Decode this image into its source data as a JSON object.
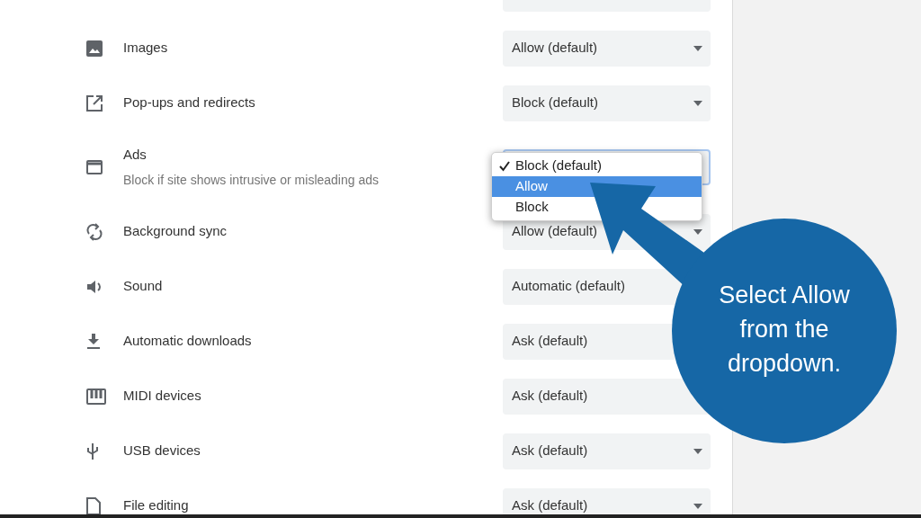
{
  "settings": [
    {
      "label": "Images",
      "value": "Allow (default)"
    },
    {
      "label": "Pop-ups and redirects",
      "value": "Block (default)"
    },
    {
      "label": "Ads",
      "description": "Block if site shows intrusive or misleading ads",
      "focused": true
    },
    {
      "label": "Background sync",
      "value": "Allow (default)"
    },
    {
      "label": "Sound",
      "value": "Automatic (default)"
    },
    {
      "label": "Automatic downloads",
      "value": "Ask (default)"
    },
    {
      "label": "MIDI devices",
      "value": "Ask (default)"
    },
    {
      "label": "USB devices",
      "value": "Ask (default)"
    },
    {
      "label": "File editing",
      "value": "Ask (default)"
    }
  ],
  "dropdown_menu": [
    {
      "label": "Block (default)",
      "checked": true,
      "selected": false
    },
    {
      "label": "Allow",
      "checked": false,
      "selected": true
    },
    {
      "label": "Block",
      "checked": false,
      "selected": false
    }
  ],
  "callout": {
    "text": "Select Allow from the dropdown."
  }
}
